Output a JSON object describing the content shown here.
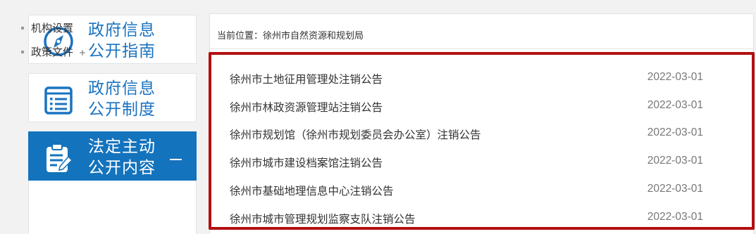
{
  "sidebar": {
    "cards": [
      {
        "label_line1": "政府信息",
        "label_line2": "公开指南",
        "icon": "compass-icon"
      },
      {
        "label_line1": "政府信息",
        "label_line2": "公开制度",
        "icon": "document-list-icon"
      },
      {
        "label_line1": "法定主动",
        "label_line2": "公开内容",
        "icon": "clipboard-edit-icon",
        "active": true
      }
    ],
    "sub_items": [
      {
        "label": "机构设置"
      },
      {
        "label": "政策文件",
        "arrow": "+"
      }
    ]
  },
  "main": {
    "breadcrumb": "当前位置：徐州市自然资源和规划局",
    "rows": [
      {
        "title": "徐州市土地征用管理处注销公告",
        "date": "2022-03-01"
      },
      {
        "title": "徐州市林政资源管理站注销公告",
        "date": "2022-03-01"
      },
      {
        "title": "徐州市规划馆（徐州市规划委员会办公室）注销公告",
        "date": "2022-03-01"
      },
      {
        "title": "徐州市城市建设档案馆注销公告",
        "date": "2022-03-01"
      },
      {
        "title": "徐州市基础地理信息中心注销公告",
        "date": "2022-03-01"
      },
      {
        "title": "徐州市城市管理规划监察支队注销公告",
        "date": "2022-03-01"
      }
    ]
  },
  "colors": {
    "accent": "#1473bd",
    "highlight": "#b3100f"
  }
}
